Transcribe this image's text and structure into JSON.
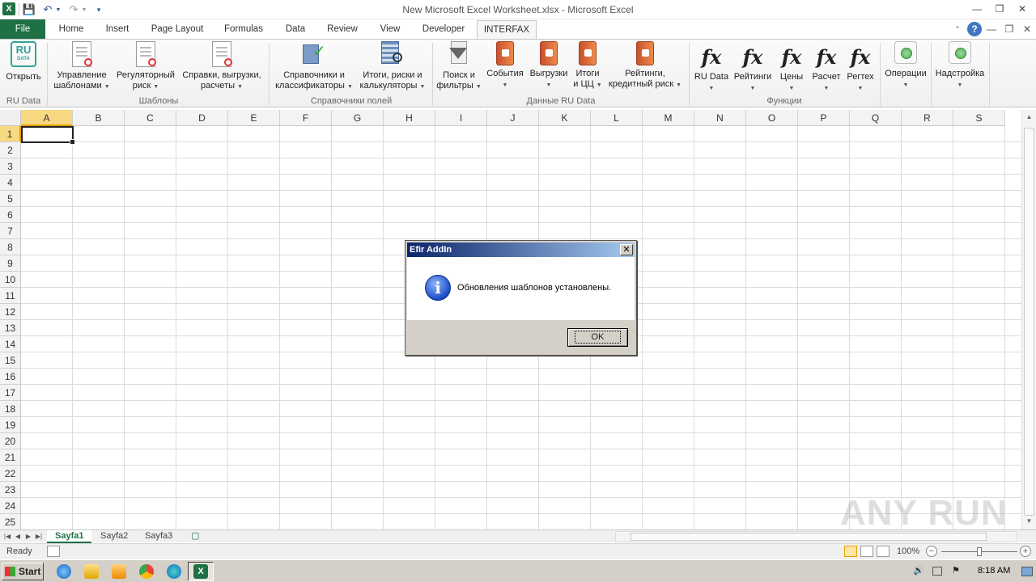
{
  "window": {
    "title": "New Microsoft Excel Worksheet.xlsx  -  Microsoft Excel",
    "app_icon": "X"
  },
  "tabs": [
    "File",
    "Home",
    "Insert",
    "Page Layout",
    "Formulas",
    "Data",
    "Review",
    "View",
    "Developer",
    "INTERFAX"
  ],
  "active_tab": "INTERFAX",
  "ribbon": {
    "ru_data": {
      "open": "Открыть",
      "group": "RU Data"
    },
    "templates": {
      "manage": [
        "Управление",
        "шаблонами"
      ],
      "regulatory": [
        "Регуляторный",
        "риск"
      ],
      "reports": [
        "Справки, выгрузки,",
        "расчеты"
      ],
      "group": "Шаблоны"
    },
    "field_refs": {
      "dicts": [
        "Справочники и",
        "классификаторы"
      ],
      "totals": [
        "Итоги, риски и",
        "калькуляторы"
      ],
      "group": "Справочники полей"
    },
    "ru_data_group": {
      "search": [
        "Поиск и",
        "фильтры"
      ],
      "events": [
        "События",
        ""
      ],
      "exports": [
        "Выгрузки",
        ""
      ],
      "totals": [
        "Итоги",
        "и ЦЦ"
      ],
      "ratings": [
        "Рейтинги,",
        "кредитный риск"
      ],
      "group": "Данные RU Data"
    },
    "functions": {
      "fx_symbol": "fx",
      "items": [
        "RU Data",
        "Рейтинги",
        "Цены",
        "Расчет",
        "Регтех"
      ],
      "group": "Функции"
    },
    "operations": "Операции",
    "settings": "Надстройка"
  },
  "grid": {
    "columns": [
      "A",
      "B",
      "C",
      "D",
      "E",
      "F",
      "G",
      "H",
      "I",
      "J",
      "K",
      "L",
      "M",
      "N",
      "O",
      "P",
      "Q",
      "R",
      "S"
    ],
    "rows": [
      "1",
      "2",
      "3",
      "4",
      "5",
      "6",
      "7",
      "8",
      "9",
      "10",
      "11",
      "12",
      "13",
      "14",
      "15",
      "16",
      "17",
      "18",
      "19",
      "20",
      "21",
      "22",
      "23",
      "24",
      "25"
    ],
    "active_cell": "A1"
  },
  "sheets": [
    "Sayfa1",
    "Sayfa2",
    "Sayfa3"
  ],
  "active_sheet": "Sayfa1",
  "status": {
    "text": "Ready",
    "zoom": "100%"
  },
  "dialog": {
    "title": "Efir AddIn",
    "message": "Обновления шаблонов установлены.",
    "ok": "OK",
    "close": "✕",
    "icon_glyph": "i"
  },
  "taskbar": {
    "start": "Start",
    "clock": "8:18 AM"
  },
  "watermark": "ANY RUN"
}
